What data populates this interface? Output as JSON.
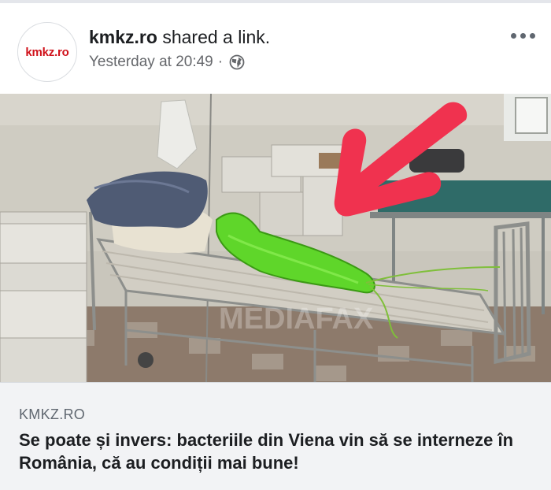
{
  "post": {
    "avatar_text": "kmkz.ro",
    "page_name": "kmkz.ro",
    "action_text": " shared a link.",
    "timestamp": "Yesterday at 20:49",
    "separator": "·",
    "audience_icon": "globe-icon",
    "more_icon": "more-options-icon"
  },
  "link": {
    "image_watermark": "MEDIAFAX",
    "domain": "KMKZ.RO",
    "title": "Se poate și invers: bacteriile din Viena vin să se interneze în România, că au condiții mai bune!"
  },
  "colors": {
    "brand_red": "#d0121b",
    "meta_gray": "#65676b",
    "caption_bg": "#f2f3f5",
    "arrow": "#f0324f",
    "bacterium": "#5fd62a"
  }
}
